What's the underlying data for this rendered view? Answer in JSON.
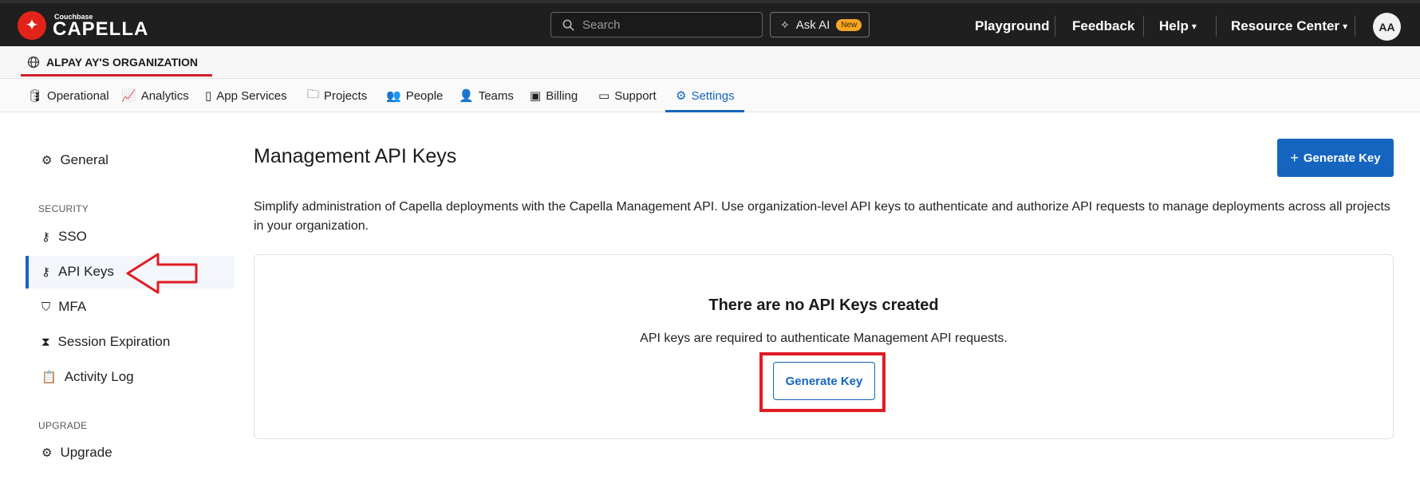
{
  "topbar": {
    "logo_small": "Couchbase",
    "logo_big": "CAPELLA",
    "search_placeholder": "Search",
    "ask_ai_label": "Ask AI",
    "ask_ai_badge": "New",
    "nav": {
      "playground": "Playground",
      "feedback": "Feedback",
      "help": "Help",
      "resource_center": "Resource Center"
    },
    "avatar_initials": "AA"
  },
  "org": {
    "name": "ALPAY AY'S ORGANIZATION"
  },
  "tabs": [
    {
      "label": "Operational",
      "icon": "database-icon"
    },
    {
      "label": "Analytics",
      "icon": "chart-icon"
    },
    {
      "label": "App Services",
      "icon": "app-services-icon"
    },
    {
      "label": "Projects",
      "icon": "folder-icon"
    },
    {
      "label": "People",
      "icon": "people-icon"
    },
    {
      "label": "Teams",
      "icon": "teams-icon"
    },
    {
      "label": "Billing",
      "icon": "billing-icon"
    },
    {
      "label": "Support",
      "icon": "support-icon"
    },
    {
      "label": "Settings",
      "icon": "gear-icon"
    }
  ],
  "active_tab": "Settings",
  "sidebar": {
    "general": "General",
    "security_heading": "SECURITY",
    "sso": "SSO",
    "api_keys": "API Keys",
    "mfa": "MFA",
    "session_expiration": "Session Expiration",
    "activity_log": "Activity Log",
    "upgrade_heading": "UPGRADE",
    "upgrade": "Upgrade"
  },
  "main": {
    "title": "Management API Keys",
    "generate_key_button": "Generate Key",
    "description": "Simplify administration of Capella deployments with the Capella Management API. Use organization-level API keys to authenticate and authorize API requests to manage deployments across all projects in your organization.",
    "empty_title": "There are no API Keys created",
    "empty_subtitle": "API keys are required to authenticate Management API requests.",
    "empty_button": "Generate Key"
  },
  "colors": {
    "accent": "#1565c0",
    "annotation_red": "#e01c24",
    "topbar_bg": "#1f1f1f",
    "logo_red": "#e2231a"
  }
}
